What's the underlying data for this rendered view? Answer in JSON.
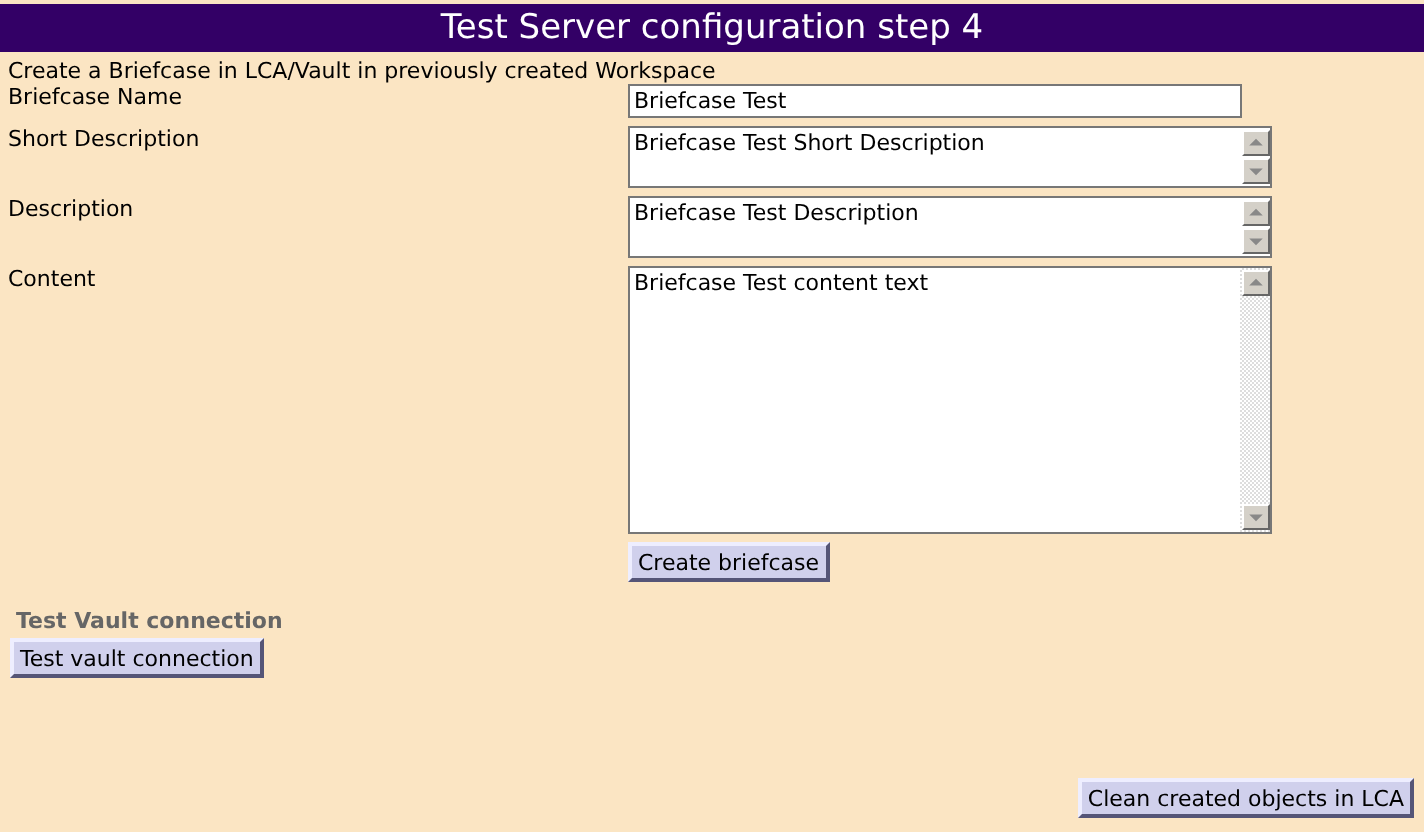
{
  "title": "Test Server configuration step 4",
  "intro": "Create a Briefcase in LCA/Vault in previously created Workspace",
  "fields": [
    {
      "kind": "line",
      "label": "Briefcase Name",
      "value": "Briefcase Test"
    },
    {
      "kind": "box",
      "label": "Short Description",
      "value": "Briefcase Test Short Description"
    },
    {
      "kind": "box",
      "label": "Description",
      "value": "Briefcase Test Description"
    },
    {
      "kind": "large-box",
      "label": "Content",
      "value": "Briefcase Test content text"
    }
  ],
  "create_button": "Create briefcase",
  "vault_section": {
    "heading": "Test Vault connection",
    "button": "Test vault connection"
  },
  "clean_button": "Clean created objects in LCA"
}
